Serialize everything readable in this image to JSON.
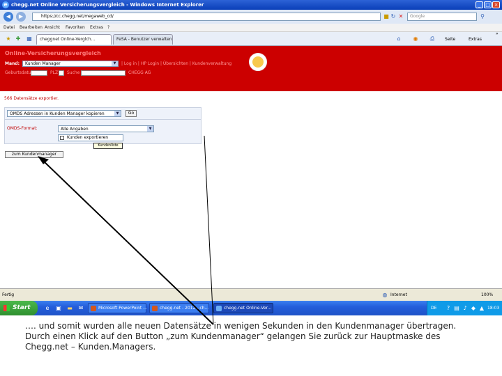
{
  "window": {
    "title": "chegg.net Online Versicherungsvergleich - Windows Internet Explorer",
    "minimize_glyph": "_",
    "maximize_glyph": "□",
    "close_glyph": "×"
  },
  "address_bar": {
    "url": "https://cc.chegg.net/megaweb_cd/",
    "search_placeholder": "Google",
    "back_glyph": "◀",
    "forward_glyph": "▶"
  },
  "menu": {
    "items": [
      "Datei",
      "Bearbeiten",
      "Ansicht",
      "Favoriten",
      "Extras",
      "?"
    ]
  },
  "tabs": [
    {
      "label": "cheggnet Online-Verglch...",
      "active": true
    },
    {
      "label": "FeSA - Benutzer verwalten",
      "active": false
    }
  ],
  "commandbar": {
    "page_label": "Seite",
    "tools_label": "Extras",
    "more_glyph": "»"
  },
  "banner": {
    "app_title": "Online-Versicherungsvergleich",
    "mandant_label": "Mand:",
    "mandant_value": "Kunden Manager",
    "links": "| Log in | HP Login | Übersichten | Kundenverwaltung",
    "geburtsdatum_label": "Geburtsdatum",
    "plz_label": "PLZ",
    "suche_label": "Suche",
    "company": "CHEGG AG"
  },
  "main": {
    "export_title": "566 Datensätze exportier.",
    "action_select_value": "OMDS Adressen in Kunden Manager kopieren",
    "go_button": "Go",
    "format_label": "OMDS-Format:",
    "data_select_value": "Alle Angaben",
    "export_customers_label": "Kunden exportieren",
    "tooltip": "Kundenliste",
    "to_manager_button": "zum Kundenmanager"
  },
  "statusbar": {
    "status": "Fertig",
    "zone": "Internet",
    "zoom": "100%"
  },
  "taskbar": {
    "start_label": "Start",
    "items": [
      {
        "label": "Microsoft PowerPoint ...",
        "active": false
      },
      {
        "label": "chegg.net - 2012 - ch...",
        "active": false
      },
      {
        "label": "chegg.net Online-Ver...",
        "active": true
      }
    ],
    "language": "DE",
    "clock": "18:03"
  },
  "caption": {
    "line1": "…. und somit wurden alle neuen Datensätze in wenigen Sekunden in den Kundenmanager übertragen.",
    "line2": "Durch einen Klick auf den Button „zum Kundenmanager“ gelangen Sie zurück zur Hauptmaske des",
    "line3": "Chegg.net – Kunden.Managers."
  }
}
